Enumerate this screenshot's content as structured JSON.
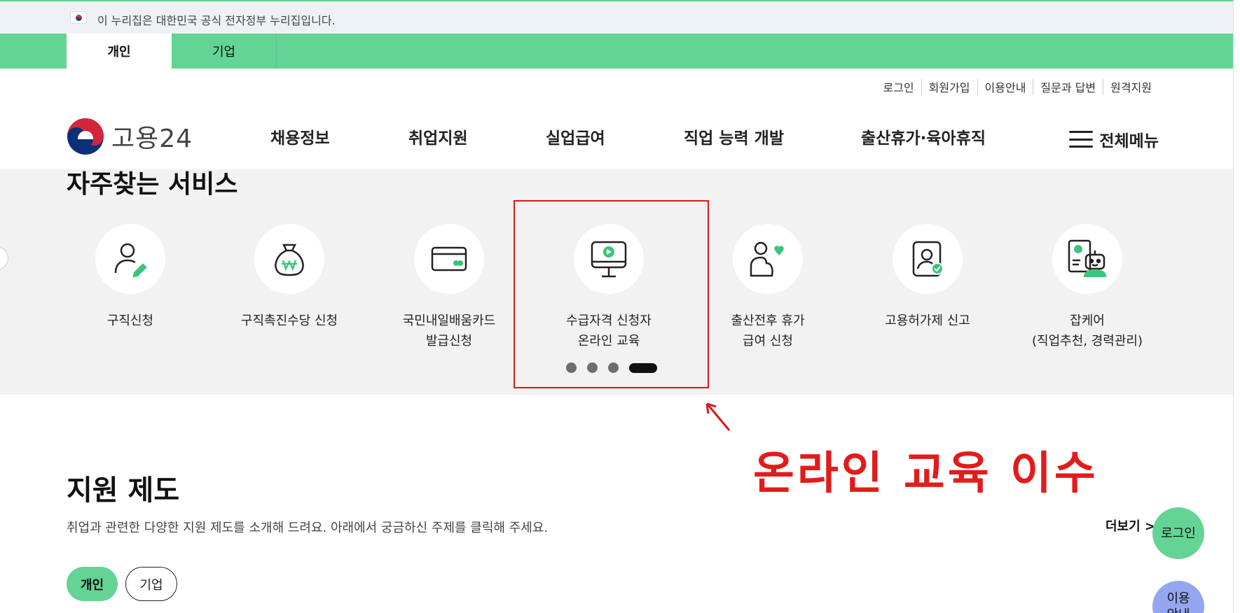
{
  "gov_banner": {
    "text": "이 누리집은 대한민국 공식 전자정부 누리집입니다."
  },
  "top_tabs": [
    {
      "label": "개인"
    },
    {
      "label": "기업"
    }
  ],
  "util_links": [
    "로그인",
    "회원가입",
    "이용안내",
    "질문과 답변",
    "원격지원"
  ],
  "logo": {
    "text": "고용24"
  },
  "gnb": [
    "채용정보",
    "취업지원",
    "실업급여",
    "직업 능력 개발",
    "출산휴가·육아휴직"
  ],
  "all_menu": {
    "label": "전체메뉴"
  },
  "services": {
    "title": "자주찾는 서비스",
    "items": [
      {
        "label": "구직신청",
        "icon": "person-edit-icon"
      },
      {
        "label": "구직촉진수당 신청",
        "icon": "money-bag-icon"
      },
      {
        "label": "국민내일배움카드\n발급신청",
        "icon": "card-icon"
      },
      {
        "label": "수급자격 신청자\n온라인 교육",
        "icon": "monitor-play-icon"
      },
      {
        "label": "출산전후 휴가\n급여 신청",
        "icon": "person-heart-icon"
      },
      {
        "label": "고용허가제 신고",
        "icon": "document-check-icon"
      },
      {
        "label": "잡케어\n(직업추천, 경력관리)",
        "icon": "robot-chart-icon"
      }
    ],
    "carousel_pages": 4,
    "carousel_active": 4
  },
  "annotation": {
    "text": "온라인 교육 이수",
    "color": "#e31b1b"
  },
  "support": {
    "title": "지원 제도",
    "description": "취업과 관련한 다양한 지원 제도를 소개해 드려요. 아래에서 궁금하신 주제를 클릭해 주세요.",
    "more_label": "더보기 >",
    "filters": [
      {
        "label": "개인",
        "active": true
      },
      {
        "label": "기업",
        "active": false
      }
    ]
  },
  "floating": {
    "login_label": "로그인",
    "guide_label": "이용\n안내"
  },
  "colors": {
    "brand_green": "#63d494",
    "highlight_red": "#d81a1a",
    "guide_blue": "#94a6f0"
  }
}
